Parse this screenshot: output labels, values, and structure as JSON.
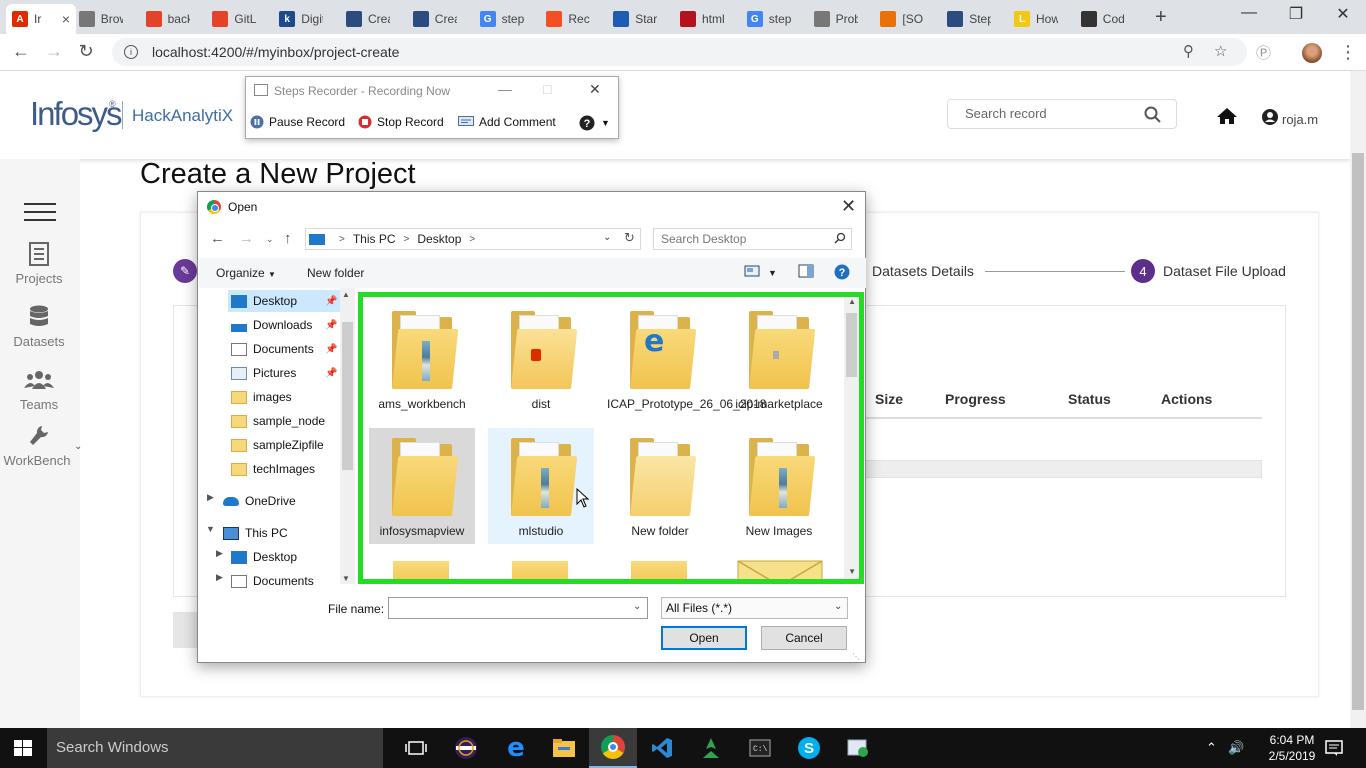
{
  "browser": {
    "tabs": [
      {
        "label": "Ir",
        "color": "#dd2c00",
        "glyph": "A"
      },
      {
        "label": "Brow",
        "color": "#777777",
        "glyph": ""
      },
      {
        "label": "back",
        "color": "#e24329",
        "glyph": ""
      },
      {
        "label": "GitLa",
        "color": "#e24329",
        "glyph": ""
      },
      {
        "label": "Digit",
        "color": "#1c4a8a",
        "glyph": "k"
      },
      {
        "label": "Creat",
        "color": "#2b4c7e",
        "glyph": ""
      },
      {
        "label": "Creat",
        "color": "#2b4c7e",
        "glyph": ""
      },
      {
        "label": "steps",
        "color": "#4285f4",
        "glyph": "G"
      },
      {
        "label": "Reco",
        "color": "#f25022",
        "glyph": ""
      },
      {
        "label": "Start",
        "color": "#1e5cb3",
        "glyph": ""
      },
      {
        "label": "html",
        "color": "#b5121b",
        "glyph": ""
      },
      {
        "label": "steps",
        "color": "#4285f4",
        "glyph": "G"
      },
      {
        "label": "Prob",
        "color": "#777777",
        "glyph": ""
      },
      {
        "label": "[SOL",
        "color": "#e8710a",
        "glyph": ""
      },
      {
        "label": "Step",
        "color": "#2b4c7e",
        "glyph": ""
      },
      {
        "label": "How",
        "color": "#f2c811",
        "glyph": "L"
      },
      {
        "label": "Code",
        "color": "#333333",
        "glyph": ""
      }
    ],
    "url": "localhost:4200/#/myinbox/project-create"
  },
  "app": {
    "logo": "Infosys",
    "logo_mark": "®",
    "product": "HackAnalytiX",
    "search_placeholder": "Search record",
    "user": "roja.m"
  },
  "leftnav": {
    "items": [
      {
        "label": "Projects",
        "icon": "projects-icon"
      },
      {
        "label": "Datasets",
        "icon": "datasets-icon"
      },
      {
        "label": "Teams",
        "icon": "teams-icon"
      },
      {
        "label": "WorkBench",
        "icon": "wrench-icon"
      }
    ]
  },
  "page": {
    "title": "Create a New Project",
    "step3": "Datasets Details",
    "step4_num": "4",
    "step4": "Dataset File Upload",
    "table_headers": [
      "Size",
      "Progress",
      "Status",
      "Actions"
    ]
  },
  "recorder": {
    "title": "Steps Recorder - Recording Now",
    "pause": "Pause Record",
    "stop": "Stop Record",
    "comment": "Add Comment"
  },
  "dialog": {
    "title": "Open",
    "crumbs": [
      "This PC",
      "Desktop"
    ],
    "search_placeholder": "Search Desktop",
    "organize": "Organize",
    "new_folder": "New folder",
    "tree": [
      {
        "label": "Desktop",
        "pinned": true
      },
      {
        "label": "Downloads",
        "pinned": true
      },
      {
        "label": "Documents",
        "pinned": true
      },
      {
        "label": "Pictures",
        "pinned": true
      },
      {
        "label": "images",
        "pinned": false
      },
      {
        "label": "sample_node",
        "pinned": false
      },
      {
        "label": "sampleZipfile",
        "pinned": false
      },
      {
        "label": "techImages",
        "pinned": false
      },
      {
        "label": "OneDrive",
        "pinned": false
      },
      {
        "label": "This PC",
        "pinned": false
      },
      {
        "label": "Desktop",
        "pinned": false
      },
      {
        "label": "Documents",
        "pinned": false
      }
    ],
    "files": [
      {
        "name": "ams_workbench"
      },
      {
        "name": "dist"
      },
      {
        "name": "ICAP_Prototype_26_06_2018"
      },
      {
        "name": "icip-marketplace"
      },
      {
        "name": "infosysmapview"
      },
      {
        "name": "mlstudio"
      },
      {
        "name": "New folder"
      },
      {
        "name": "New Images"
      }
    ],
    "filename_label": "File name:",
    "filename_value": "",
    "filetype": "All Files (*.*)",
    "open": "Open",
    "cancel": "Cancel"
  },
  "taskbar": {
    "search": "Search Windows",
    "time": "6:04 PM",
    "date": "2/5/2019"
  }
}
